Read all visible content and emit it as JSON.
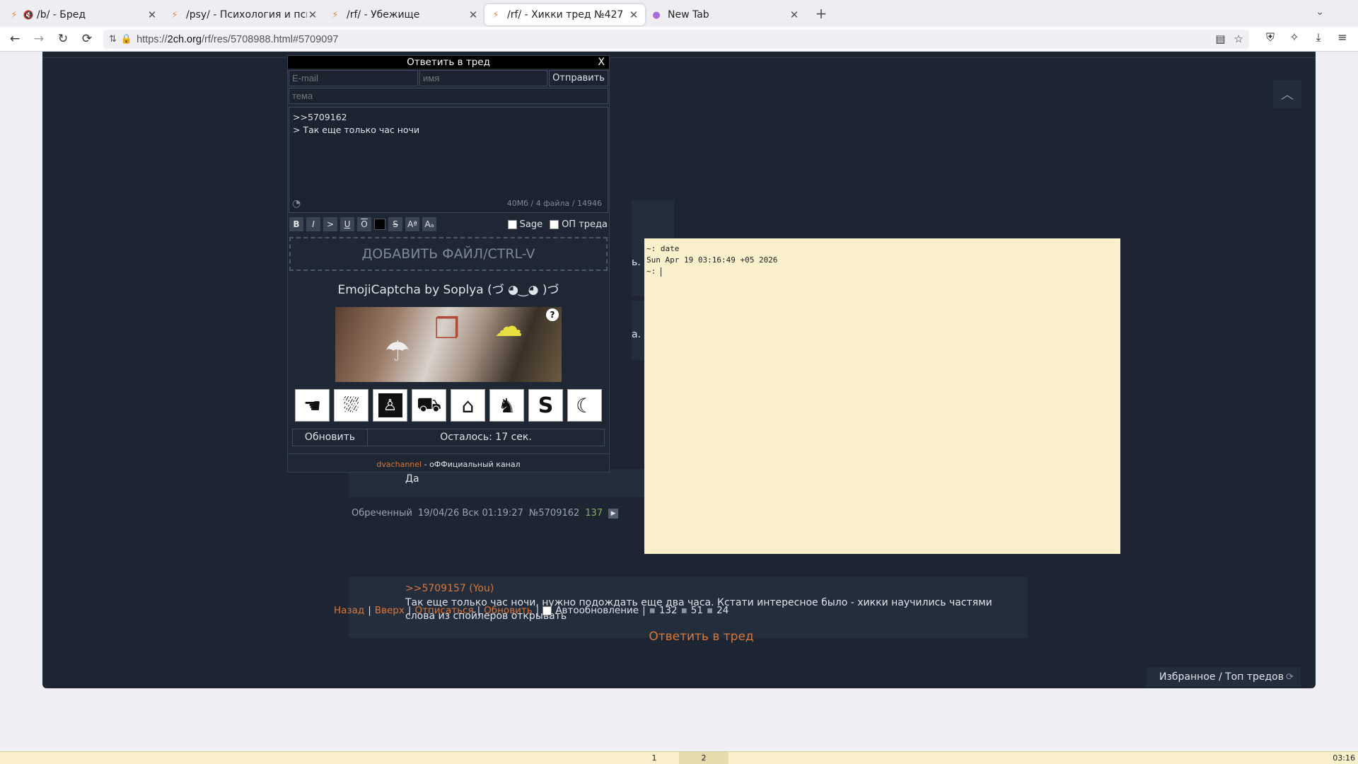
{
  "browser": {
    "tabs": [
      {
        "title": "/b/ - Бред",
        "muted": true,
        "active": false
      },
      {
        "title": "/psy/ - Психология и психиатрия",
        "muted": false,
        "active": false
      },
      {
        "title": "/rf/ - Убежище",
        "muted": false,
        "active": false
      },
      {
        "title": "/rf/ - Хикки тред №427",
        "muted": false,
        "active": true
      },
      {
        "title": "New Tab",
        "muted": false,
        "active": false
      }
    ],
    "url_prefix": "https://",
    "url_domain": "2ch.org",
    "url_path": "/rf/res/5708988.html#5709097"
  },
  "reply_form": {
    "title": "Ответить в тред",
    "close": "X",
    "email_placeholder": "E-mail",
    "name_placeholder": "имя",
    "submit_label": "Отправить",
    "subject_placeholder": "тема",
    "message_lines": [
      ">>5709162",
      "> Так еще только час ночи"
    ],
    "stats": "40Мб / 4 файла / 14946",
    "markup_buttons": [
      "B",
      "I",
      ">",
      "U",
      "O",
      "",
      "S",
      "Aª",
      "Aₐ"
    ],
    "sage_label": "Sage",
    "op_label": "ОП треда",
    "dropzone": "ДОБАВИТЬ ФАЙЛ/CTRL-V",
    "captcha_title": "EmojiCaptcha by Soplya (づ ◕‿◕ )づ",
    "captcha_help": "?",
    "captcha_emojis": [
      "hand-emoji",
      "cloud-rain-emoji",
      "person-emoji",
      "car-emoji",
      "tombstone-emoji",
      "gorilla-emoji",
      "letter-s-emoji",
      "dolphin-emoji"
    ],
    "refresh_label": "Обновить",
    "timer_label": "Осталось: 17 сек.",
    "footer_link": "dvachannel",
    "footer_text": " - оФФициальный канал"
  },
  "posts": {
    "previous_text": "Да",
    "author": "Обреченный",
    "date": "19/04/26 Вск 01:19:27",
    "number": "№5709162",
    "count": "137",
    "reply_link": ">>5709157 (You)",
    "body": "Так еще только час ночи, нужно подождать еще два часа. Кстати интересное было - хикки научились частями слова из спойлеров открывать"
  },
  "thread_nav": {
    "back": "Назад",
    "top": "Вверх",
    "unsubscribe": "Отписаться",
    "refresh": "Обновить",
    "autoupdate": "Автообновление",
    "posts_count": "132",
    "images_count": "51",
    "users_count": "24",
    "reply_in_thread": "Ответить в тред",
    "favorites": "Избранное / Топ тредов"
  },
  "terminal": {
    "lines": [
      "~: date",
      "Sun Apr 19 03:16:49 +05 2026",
      "~: "
    ]
  },
  "taskbar": {
    "workspaces": [
      "1",
      "2"
    ],
    "active_workspace": "2",
    "clock": "03:16"
  }
}
